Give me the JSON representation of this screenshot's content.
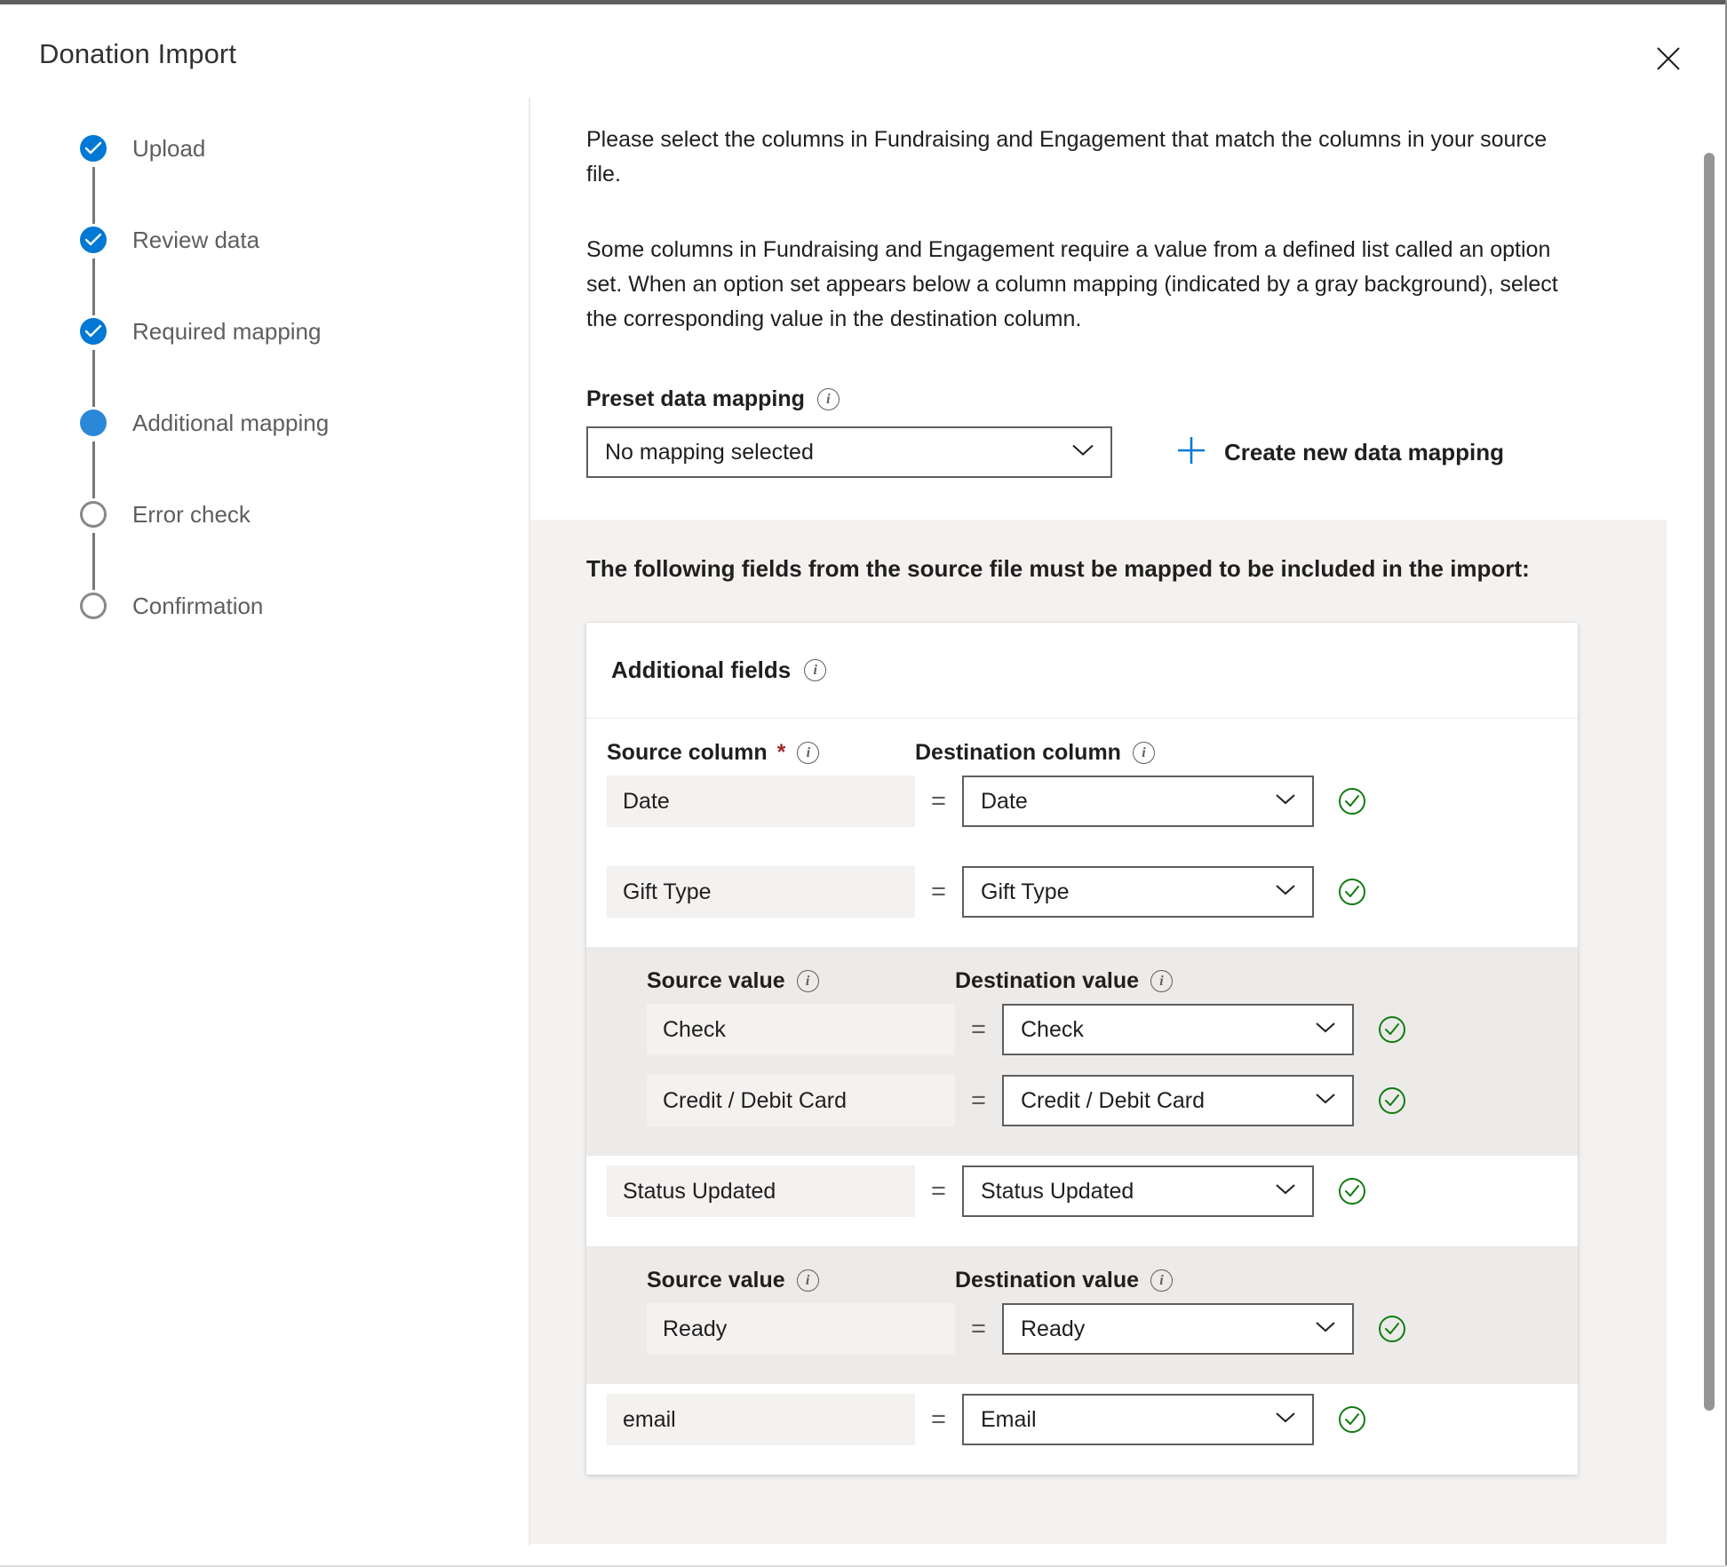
{
  "window": {
    "title": "Donation Import",
    "close_icon": "close-icon"
  },
  "stepper": {
    "steps": [
      {
        "label": "Upload",
        "state": "done"
      },
      {
        "label": "Review data",
        "state": "done"
      },
      {
        "label": "Required mapping",
        "state": "done"
      },
      {
        "label": "Additional mapping",
        "state": "current"
      },
      {
        "label": "Error check",
        "state": "todo"
      },
      {
        "label": "Confirmation",
        "state": "todo"
      }
    ]
  },
  "intro": {
    "paragraph1": "Please select the columns in Fundraising and Engagement that match the columns in your source file.",
    "paragraph2": "Some columns in Fundraising and Engagement require a value from a defined list called an option set. When an option set appears below a column mapping (indicated by a gray background), select the corresponding value in the destination column."
  },
  "preset": {
    "label": "Preset data mapping",
    "info_icon": "info-icon",
    "selected": "No mapping selected",
    "chevron_icon": "chevron-down-icon",
    "create_label": "Create new data mapping",
    "plus_icon": "plus-icon"
  },
  "section": {
    "heading": "The following fields from the source file must be mapped to be included in the import:",
    "card_title": "Additional fields",
    "card_info_icon": "info-icon"
  },
  "headers": {
    "source_column": "Source column",
    "source_required_mark": "*",
    "destination_column": "Destination column",
    "source_value": "Source value",
    "destination_value": "Destination value"
  },
  "mappings": [
    {
      "type": "column",
      "show_header": true,
      "source": "Date",
      "destination": "Date",
      "status_icon": "check-circle-icon"
    },
    {
      "type": "column",
      "show_header": false,
      "source": "Gift Type",
      "destination": "Gift Type",
      "status_icon": "check-circle-icon"
    },
    {
      "type": "optionset",
      "values": [
        {
          "source": "Check",
          "destination": "Check",
          "status_icon": "check-circle-icon"
        },
        {
          "source": "Credit / Debit Card",
          "destination": "Credit / Debit Card",
          "status_icon": "check-circle-icon"
        }
      ]
    },
    {
      "type": "column",
      "show_header": false,
      "source": "Status Updated",
      "destination": "Status Updated",
      "status_icon": "check-circle-icon"
    },
    {
      "type": "optionset",
      "values": [
        {
          "source": "Ready",
          "destination": "Ready",
          "status_icon": "check-circle-icon"
        }
      ]
    },
    {
      "type": "column",
      "show_header": false,
      "source": "email",
      "destination": "Email",
      "status_icon": "check-circle-icon"
    }
  ],
  "colors": {
    "accent": "#0078d4",
    "current_step": "#2b88d8",
    "success": "#107c10",
    "required": "#a4262c",
    "gray_bg": "#f3f2f1",
    "shaded_bg": "#edebe9",
    "border": "#605e5c"
  }
}
